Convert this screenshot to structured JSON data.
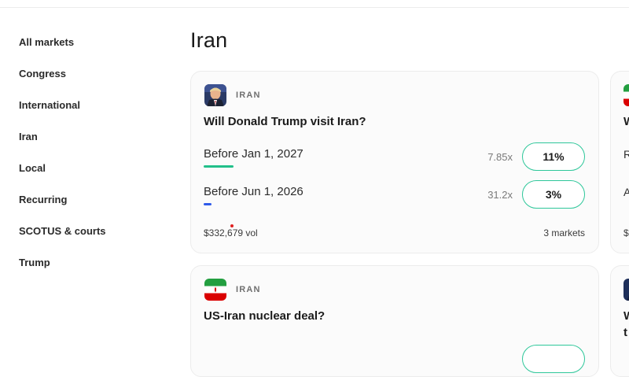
{
  "sidebar": {
    "items": [
      {
        "label": "All markets"
      },
      {
        "label": "Congress"
      },
      {
        "label": "International"
      },
      {
        "label": "Iran"
      },
      {
        "label": "Local"
      },
      {
        "label": "Recurring"
      },
      {
        "label": "SCOTUS & courts"
      },
      {
        "label": "Trump"
      }
    ]
  },
  "page": {
    "title": "Iran"
  },
  "cards": [
    {
      "tag": "IRAN",
      "title": "Will Donald Trump visit Iran?",
      "icon": "trump-portrait-icon",
      "outcomes": [
        {
          "label": "Before Jan 1, 2027",
          "multiplier": "7.85x",
          "percent": "11%",
          "bar_fraction": 0.42,
          "bar_color": "#22c08a"
        },
        {
          "label": "Before Jun 1, 2026",
          "multiplier": "31.2x",
          "percent": "3%",
          "bar_fraction": 0.11,
          "bar_color": "#2f5bea"
        }
      ],
      "volume": "$332,679 vol",
      "markets": "3 markets"
    },
    {
      "tag": "IRAN",
      "title": "US-Iran nuclear deal?",
      "icon": "iran-flag-icon"
    }
  ],
  "peek": {
    "card1": {
      "title_letter": "W",
      "row1_letter": "R",
      "row2_letter": "A",
      "footer_letter": "$"
    },
    "card2": {
      "title_line1": "W",
      "title_line2": "t"
    }
  },
  "colors": {
    "accent_green": "#22c08a",
    "accent_blue": "#2f5bea",
    "button_border": "#2ec79a"
  }
}
